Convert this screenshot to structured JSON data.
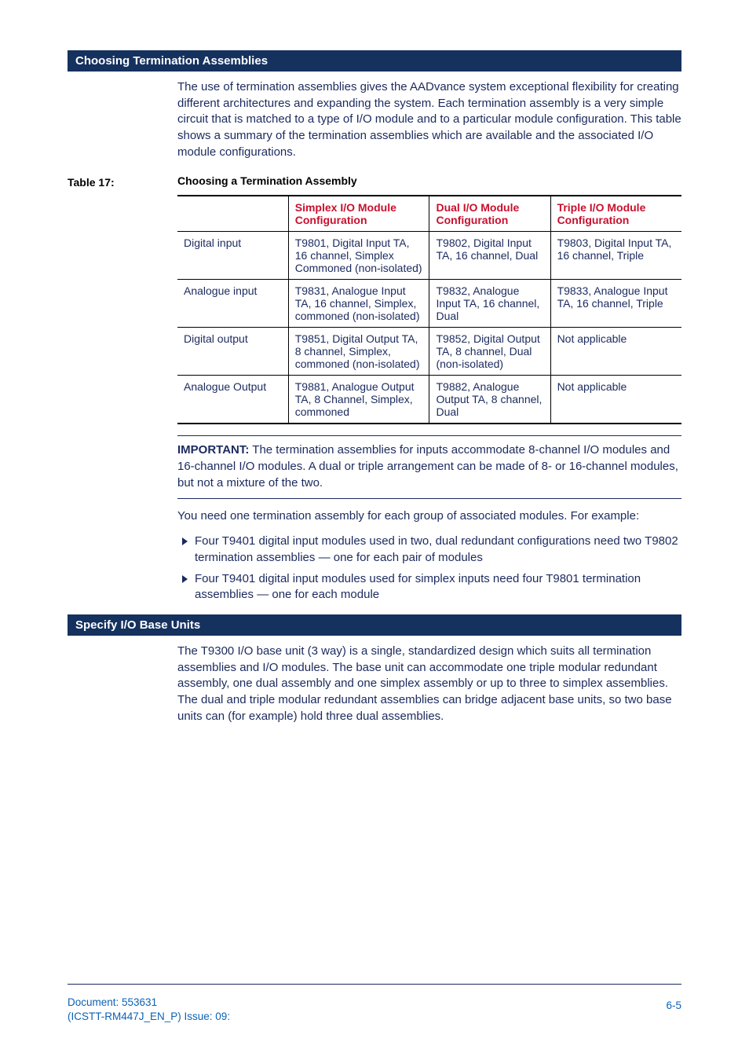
{
  "section1": {
    "title": "Choosing Termination Assemblies",
    "para": "The use of termination assemblies gives the AADvance system exceptional flexibility for creating different architectures and expanding the system. Each termination assembly is a very simple circuit that is matched to a type of I/O module and to a particular module configuration. This table shows a summary of the termination assemblies which are available and the associated I/O module configurations."
  },
  "table17": {
    "label": "Table 17:",
    "caption": "Choosing a Termination Assembly",
    "headers": {
      "c0": "",
      "c1": "Simplex I/O Module Configuration",
      "c2": "Dual I/O Module Configuration",
      "c3": "Triple I/O Module Configuration"
    },
    "rows": [
      {
        "c0": "Digital input",
        "c1": "T9801, Digital Input TA,  16 channel, Simplex Commoned (non-isolated)",
        "c2": "T9802, Digital Input TA, 16 channel, Dual",
        "c3": "T9803, Digital Input TA, 16 channel, Triple"
      },
      {
        "c0": "Analogue input",
        "c1": "T9831, Analogue Input TA, 16 channel, Simplex, commoned (non-isolated)",
        "c2": "T9832, Analogue Input TA, 16 channel, Dual",
        "c3": "T9833, Analogue Input TA, 16 channel, Triple"
      },
      {
        "c0": "Digital output",
        "c1": "T9851, Digital Output TA, 8 channel, Simplex, commoned (non-isolated)",
        "c2": "T9852, Digital Output TA, 8 channel, Dual (non-isolated)",
        "c3": "Not applicable"
      },
      {
        "c0": "Analogue Output",
        "c1": "T9881, Analogue Output TA, 8 Channel, Simplex, commoned",
        "c2": "T9882, Analogue Output TA, 8 channel, Dual",
        "c3": "Not applicable"
      }
    ]
  },
  "important": {
    "label": "IMPORTANT:",
    "text": " The termination assemblies for inputs accommodate 8-channel I/O modules and 16-channel I/O modules. A dual or triple arrangement can be made of 8- or 16-channel modules, but not a mixture of the two."
  },
  "after_important": {
    "para": "You need one termination assembly for each group of associated modules. For example:",
    "bullets": [
      "Four T9401 digital input modules used in two, dual redundant configurations need two T9802 termination assemblies — one for each pair of modules",
      "Four T9401 digital input modules used for simplex inputs need four T9801 termination assemblies — one for each module"
    ]
  },
  "section2": {
    "title": "Specify I/O Base Units",
    "para": "The T9300 I/O base unit (3 way) is a single, standardized design which suits all termination assemblies and I/O modules. The base unit can accommodate one triple modular redundant assembly, one dual assembly and one simplex assembly or up to three to simplex assemblies. The dual and triple modular redundant assemblies can bridge adjacent base units, so two base units can (for example) hold three dual assemblies."
  },
  "footer": {
    "line1": "Document: 553631",
    "line2": "(ICSTT-RM447J_EN_P) Issue: 09:",
    "pagenum": "6-5"
  }
}
